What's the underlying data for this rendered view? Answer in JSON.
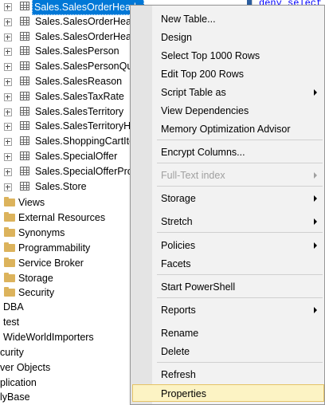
{
  "editor": {
    "code_fragment": "deny select"
  },
  "tree": {
    "tables": [
      {
        "label": "Sales.SalesOrderHeade",
        "selected": true
      },
      {
        "label": "Sales.SalesOrderHeade"
      },
      {
        "label": "Sales.SalesOrderHeade"
      },
      {
        "label": "Sales.SalesPerson"
      },
      {
        "label": "Sales.SalesPersonQuot"
      },
      {
        "label": "Sales.SalesReason"
      },
      {
        "label": "Sales.SalesTaxRate"
      },
      {
        "label": "Sales.SalesTerritory"
      },
      {
        "label": "Sales.SalesTerritoryHis"
      },
      {
        "label": "Sales.ShoppingCartIte"
      },
      {
        "label": "Sales.SpecialOffer"
      },
      {
        "label": "Sales.SpecialOfferProd"
      },
      {
        "label": "Sales.Store"
      }
    ],
    "folders": [
      {
        "label": "Views"
      },
      {
        "label": "External Resources"
      },
      {
        "label": "Synonyms"
      },
      {
        "label": "Programmability"
      },
      {
        "label": "Service Broker"
      },
      {
        "label": "Storage"
      },
      {
        "label": "Security"
      }
    ],
    "databases": [
      {
        "label": "DBA"
      },
      {
        "label": "test"
      },
      {
        "label": "WideWorldImporters"
      }
    ],
    "server_nodes": [
      {
        "label": "curity"
      },
      {
        "label": "ver Objects"
      },
      {
        "label": "plication"
      },
      {
        "label": "lyBase"
      }
    ]
  },
  "menu": {
    "items": [
      {
        "label": "New Table..."
      },
      {
        "label": "Design"
      },
      {
        "label": "Select Top 1000 Rows"
      },
      {
        "label": "Edit Top 200 Rows"
      },
      {
        "label": "Script Table as",
        "submenu": true
      },
      {
        "label": "View Dependencies"
      },
      {
        "label": "Memory Optimization Advisor"
      },
      {
        "label": "Encrypt Columns..."
      },
      {
        "label": "Full-Text index",
        "submenu": true,
        "disabled": true
      },
      {
        "label": "Storage",
        "submenu": true
      },
      {
        "label": "Stretch",
        "submenu": true
      },
      {
        "label": "Policies",
        "submenu": true
      },
      {
        "label": "Facets"
      },
      {
        "label": "Start PowerShell"
      },
      {
        "label": "Reports",
        "submenu": true
      },
      {
        "label": "Rename"
      },
      {
        "label": "Delete"
      },
      {
        "label": "Refresh"
      },
      {
        "label": "Properties",
        "highlighted": true
      }
    ]
  }
}
